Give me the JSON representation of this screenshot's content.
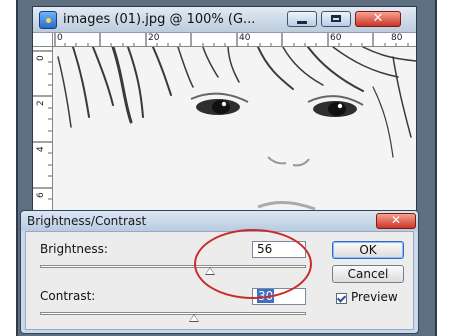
{
  "document_window": {
    "title": "images (01).jpg @ 100% (G...",
    "icon": "photoshop-document-icon",
    "controls": {
      "minimize": "minimize-icon",
      "maximize": "maximize-icon",
      "close": "close-icon"
    },
    "ruler_top_labels": [
      "0",
      "20",
      "40",
      "60",
      "80"
    ],
    "ruler_left_labels": [
      "0",
      "2",
      "4",
      "6"
    ]
  },
  "dialog": {
    "title": "Brightness/Contrast",
    "close_icon": "close-icon",
    "brightness_label": "Brightness:",
    "brightness_value": "56",
    "brightness_level": 0.64,
    "contrast_label": "Contrast:",
    "contrast_value": "30",
    "contrast_level": 0.58,
    "ok_label": "OK",
    "cancel_label": "Cancel",
    "preview_label": "Preview",
    "preview_checked": true
  },
  "annotation": {
    "color": "#cc2b2b"
  }
}
